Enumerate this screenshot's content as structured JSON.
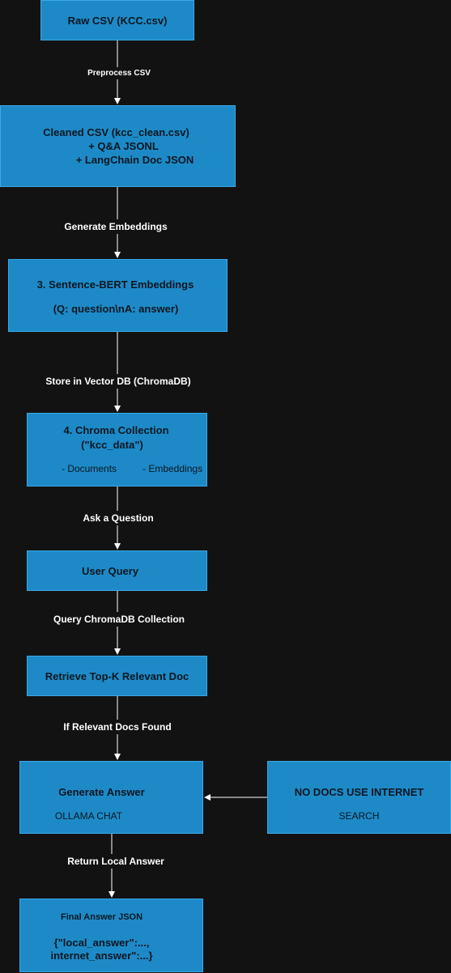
{
  "colors": {
    "background": "#121212",
    "box_fill": "#1d8ac7",
    "box_border": "#3aa8e8",
    "arrow": "#ffffff",
    "box_text": "#0c1620"
  },
  "nodes": {
    "raw_csv": {
      "title": "Raw CSV (KCC.csv)"
    },
    "cleaned_csv": {
      "line1": "Cleaned CSV (kcc_clean.csv)",
      "line2": "+ Q&A JSONL",
      "line3": "+ LangChain Doc JSON"
    },
    "embeddings": {
      "line1": "3. Sentence-BERT Embeddings",
      "line2": "(Q: question\\nA: answer)"
    },
    "chroma": {
      "line1": "4. Chroma Collection",
      "line2": "(\"kcc_data\")",
      "item1": "- Documents",
      "item2": "- Embeddings"
    },
    "user_query": {
      "title": "User Query"
    },
    "retrieve": {
      "title": "Retrieve Top-K Relevant Doc"
    },
    "generate": {
      "title": "Generate Answer",
      "subtitle": "OLLAMA CHAT"
    },
    "no_docs": {
      "title": "NO DOCS USE INTERNET",
      "subtitle": "SEARCH"
    },
    "final": {
      "title": "Final Answer JSON",
      "line2": "{\"local_answer\":...,",
      "line3": "internet_answer\":...}"
    }
  },
  "edges": {
    "preprocess": "Preprocess CSV",
    "generate_embeddings": "Generate Embeddings",
    "store_vector": "Store in Vector DB (ChromaDB)",
    "ask_question": "Ask a Question",
    "query_chroma": "Query ChromaDB Collection",
    "if_relevant": "If Relevant Docs Found",
    "return_local": "Return Local Answer"
  }
}
